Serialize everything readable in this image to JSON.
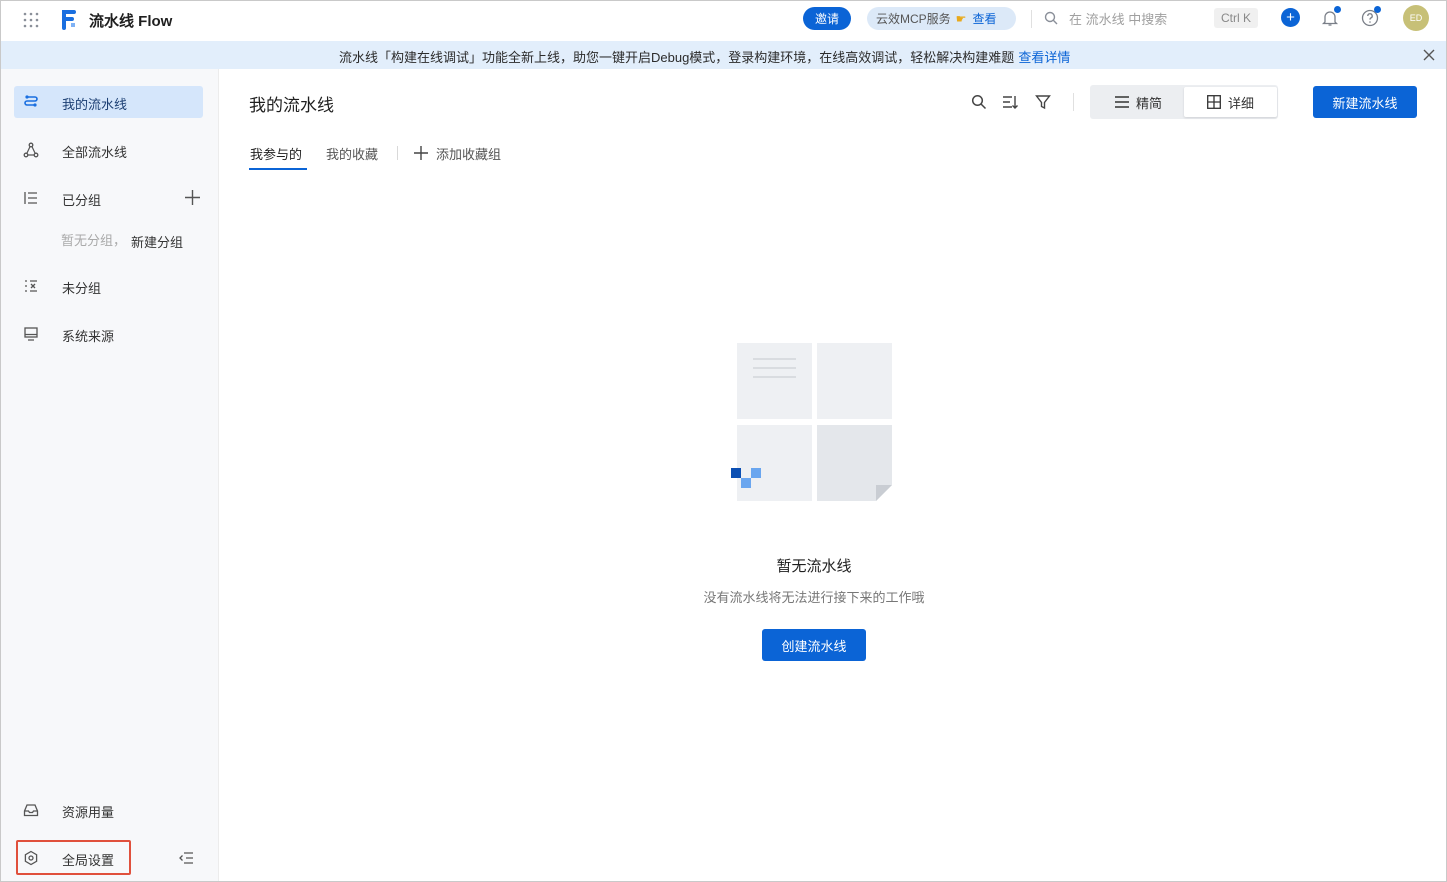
{
  "topbar": {
    "app_title": "流水线 Flow",
    "invite_label": "邀请",
    "mcp_label": "云效MCP服务",
    "mcp_view_label": "查看",
    "search_placeholder": "在 流水线 中搜索",
    "shortcut": "Ctrl K",
    "avatar_initials": "ED"
  },
  "announcement": {
    "text": "流水线「构建在线调试」功能全新上线，助您一键开启Debug模式，登录构建环境，在线高效调试，轻松解决构建难题",
    "link": "查看详情"
  },
  "sidebar": {
    "items": [
      {
        "label": "我的流水线",
        "icon": "pipeline-icon",
        "active": true
      },
      {
        "label": "全部流水线",
        "icon": "nodes-icon"
      },
      {
        "label": "已分组",
        "icon": "list-icon"
      },
      {
        "label": "未分组",
        "icon": "list-x-icon"
      },
      {
        "label": "系统来源",
        "icon": "monitor-icon"
      }
    ],
    "group_empty": "暂无分组，",
    "group_new": "新建分组",
    "bottom": [
      {
        "label": "资源用量",
        "icon": "inbox-icon"
      },
      {
        "label": "全局设置",
        "icon": "settings-icon"
      }
    ]
  },
  "main": {
    "title": "我的流水线",
    "view_compact": "精简",
    "view_detail": "详细",
    "new_button": "新建流水线",
    "tabs": [
      {
        "label": "我参与的",
        "active": true
      },
      {
        "label": "我的收藏"
      }
    ],
    "add_group": "添加收藏组",
    "empty_title": "暂无流水线",
    "empty_subtitle": "没有流水线将无法进行接下来的工作哦",
    "create_button": "创建流水线"
  },
  "colors": {
    "accent": "#0b64d6",
    "sidebar_bg": "#f7f8fa",
    "active_item_bg": "#d5e6fb",
    "announce_bg": "#e2eefb",
    "highlight": "#e0503c"
  }
}
